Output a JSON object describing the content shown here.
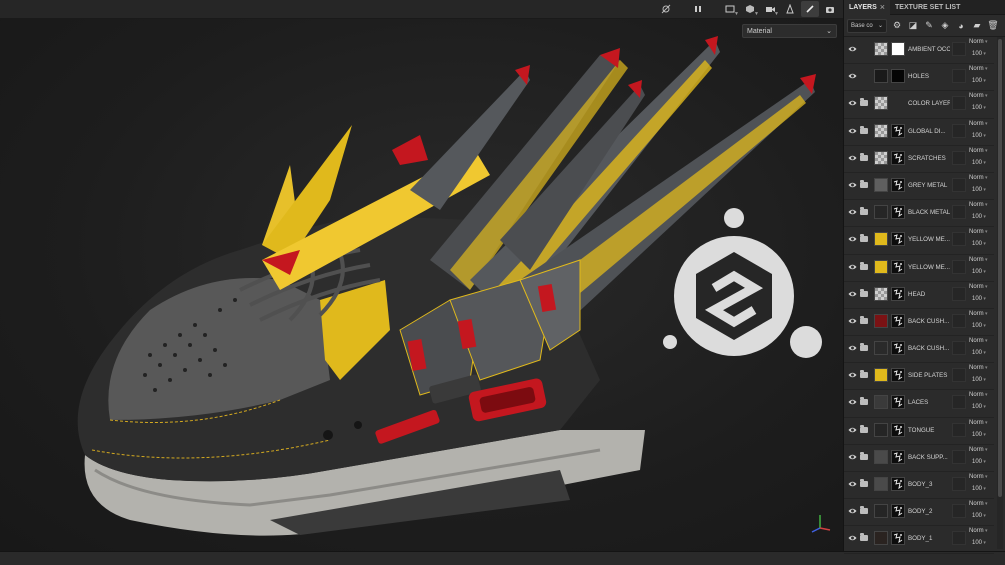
{
  "viewport": {
    "material_select": {
      "value": "Material"
    },
    "toolbar_icons": [
      "hide-ui-icon",
      "pause-icon",
      "display-mode-icon",
      "3d-view-icon",
      "camera-icon",
      "lighting-icon",
      "paint-brush-icon",
      "screenshot-icon"
    ],
    "colors": {
      "yellow": "#e0b91c",
      "red": "#c4171f",
      "grey_metal": "#5a5c5f",
      "dark": "#2f2f2f",
      "sole": "#b8b8b4"
    }
  },
  "panel": {
    "tabs": [
      {
        "label": "LAYERS",
        "close": "×"
      },
      {
        "label": "TEXTURE SET LIST"
      }
    ],
    "channel_select": "Base co",
    "toolbar_icons": [
      "add-effect-icon",
      "add-mask-icon",
      "add-paint-layer-icon",
      "add-fill-layer-icon",
      "add-smart-material-icon",
      "add-folder-icon",
      "delete-icon"
    ],
    "layers": [
      {
        "name": "AMBIENT OCCL...",
        "blend": "Norm",
        "opacity": "100",
        "thumb": "checker",
        "mask": "#ffffff",
        "folder": false
      },
      {
        "name": "HOLES",
        "blend": "Norm",
        "opacity": "100",
        "thumb": "#1a1a1a",
        "mask": "#050505",
        "folder": false
      },
      {
        "name": "COLOR LAYERS",
        "blend": "Norm",
        "opacity": "100",
        "thumb": "checker",
        "mask": "none",
        "folder": true
      },
      {
        "name": "GLOBAL DI...",
        "blend": "Norm",
        "opacity": "100",
        "thumb": "checker",
        "mask": "pattern",
        "folder": true
      },
      {
        "name": "SCRATCHES",
        "blend": "Norm",
        "opacity": "100",
        "thumb": "checker",
        "mask": "pattern",
        "folder": true
      },
      {
        "name": "GREY METAL",
        "blend": "Norm",
        "opacity": "100",
        "thumb": "#5f5f5f",
        "mask": "pattern",
        "folder": true
      },
      {
        "name": "BLACK METAL",
        "blend": "Norm",
        "opacity": "100",
        "thumb": "#262626",
        "mask": "pattern",
        "folder": true
      },
      {
        "name": "YELLOW ME...",
        "blend": "Norm",
        "opacity": "100",
        "thumb": "#e0b91c",
        "mask": "pattern",
        "folder": true
      },
      {
        "name": "YELLOW ME...",
        "blend": "Norm",
        "opacity": "100",
        "thumb": "#e0b91c",
        "mask": "pattern",
        "folder": true
      },
      {
        "name": "HEAD",
        "blend": "Norm",
        "opacity": "100",
        "thumb": "checker",
        "mask": "pattern",
        "folder": true
      },
      {
        "name": "BACK CUSH...",
        "blend": "Norm",
        "opacity": "100",
        "thumb": "#7a1214",
        "mask": "pattern",
        "folder": true
      },
      {
        "name": "BACK CUSH...",
        "blend": "Norm",
        "opacity": "100",
        "thumb": "#2a2a2a",
        "mask": "pattern",
        "folder": true
      },
      {
        "name": "SIDE PLATES",
        "blend": "Norm",
        "opacity": "100",
        "thumb": "#e0b91c",
        "mask": "pattern",
        "folder": true
      },
      {
        "name": "LACES",
        "blend": "Norm",
        "opacity": "100",
        "thumb": "#3a3a3a",
        "mask": "pattern",
        "folder": true
      },
      {
        "name": "TONGUE",
        "blend": "Norm",
        "opacity": "100",
        "thumb": "#252525",
        "mask": "pattern",
        "folder": true
      },
      {
        "name": "BACK SUPP...",
        "blend": "Norm",
        "opacity": "100",
        "thumb": "#4a4a4a",
        "mask": "pattern",
        "folder": true
      },
      {
        "name": "BODY_3",
        "blend": "Norm",
        "opacity": "100",
        "thumb": "#4a4a4a",
        "mask": "pattern",
        "folder": true
      },
      {
        "name": "BODY_2",
        "blend": "Norm",
        "opacity": "100",
        "thumb": "#252525",
        "mask": "pattern",
        "folder": true
      },
      {
        "name": "BODY_1",
        "blend": "Norm",
        "opacity": "100",
        "thumb": "#2a2320",
        "mask": "pattern",
        "folder": true
      }
    ]
  }
}
